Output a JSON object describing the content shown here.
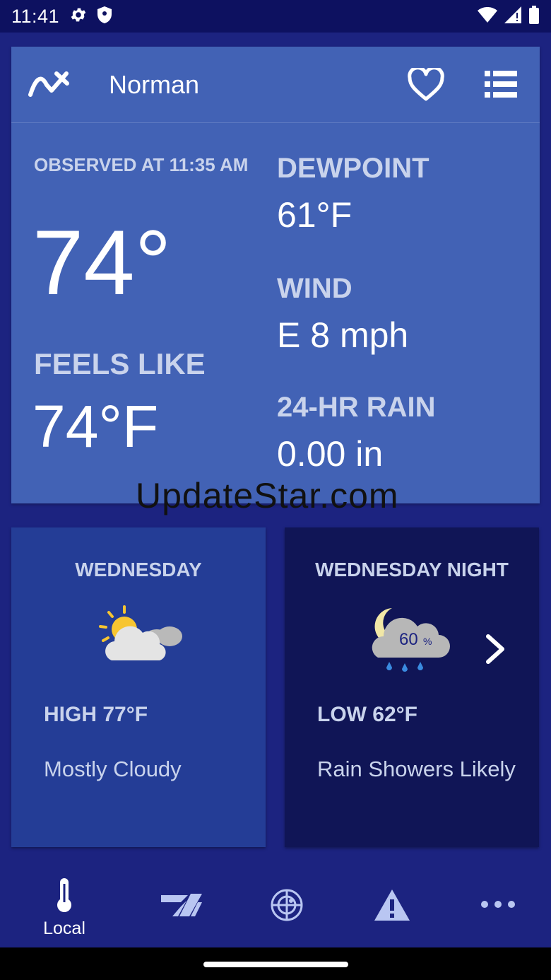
{
  "status_bar": {
    "time": "11:41"
  },
  "header": {
    "location": "Norman"
  },
  "current": {
    "observed": "OBSERVED AT 11:35 AM",
    "temperature": "74°",
    "feels_like_label": "FEELS LIKE",
    "feels_like_value": "74°F",
    "dewpoint_label": "DEWPOINT",
    "dewpoint_value": "61°F",
    "wind_label": "WIND",
    "wind_value": "E 8 mph",
    "rain_label": "24-HR RAIN",
    "rain_value": "0.00 in"
  },
  "watermark": "UpdateStar.com",
  "forecast": [
    {
      "title": "WEDNESDAY",
      "temp": "HIGH 77°F",
      "desc": "Mostly Cloudy",
      "icon": "partly-cloudy-icon"
    },
    {
      "title": "WEDNESDAY NIGHT",
      "temp": "LOW 62°F",
      "desc": "Rain Showers Likely",
      "icon": "night-rain-icon",
      "precip": "60",
      "precip_unit": "%"
    }
  ],
  "nav": {
    "local_label": "Local"
  },
  "colors": {
    "background": "#1c2380",
    "card": "#4262b5",
    "day_card": "#243d96",
    "night_card": "#101556"
  }
}
